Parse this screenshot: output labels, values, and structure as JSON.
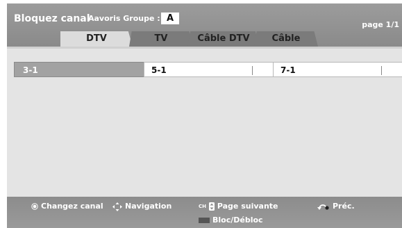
{
  "header": {
    "title": "Bloquez canal",
    "group_label": "Aavoris Groupe :",
    "group_value": "A",
    "page_indicator": "page 1/1"
  },
  "tabs": [
    {
      "label": "DTV",
      "active": true
    },
    {
      "label": "TV",
      "active": false
    },
    {
      "label": "Câble DTV",
      "active": false
    },
    {
      "label": "Câble",
      "active": false
    }
  ],
  "channels": [
    {
      "number": "3-1",
      "selected": true
    },
    {
      "number": "5-1",
      "selected": false
    },
    {
      "number": "7-1",
      "selected": false
    }
  ],
  "footer": {
    "change_channel": "Changez canal",
    "navigation": "Navigation",
    "ch_icon_text": "CH",
    "next_page": "Page suivante",
    "previous": "Préc.",
    "block_unblock": "Bloc/Débloc"
  },
  "colors": {
    "header_bg": "#8f8f8f",
    "panel_bg": "#e4e4e4",
    "selected_cell": "#a2a2a2",
    "color_key": "#555555"
  },
  "icons": {
    "change_channel": "radio-dot-icon",
    "navigation": "four-way-arrow-icon",
    "next_page": "ch-rocker-icon",
    "previous": "back-arrow-icon",
    "block_unblock": "color-key-icon"
  }
}
